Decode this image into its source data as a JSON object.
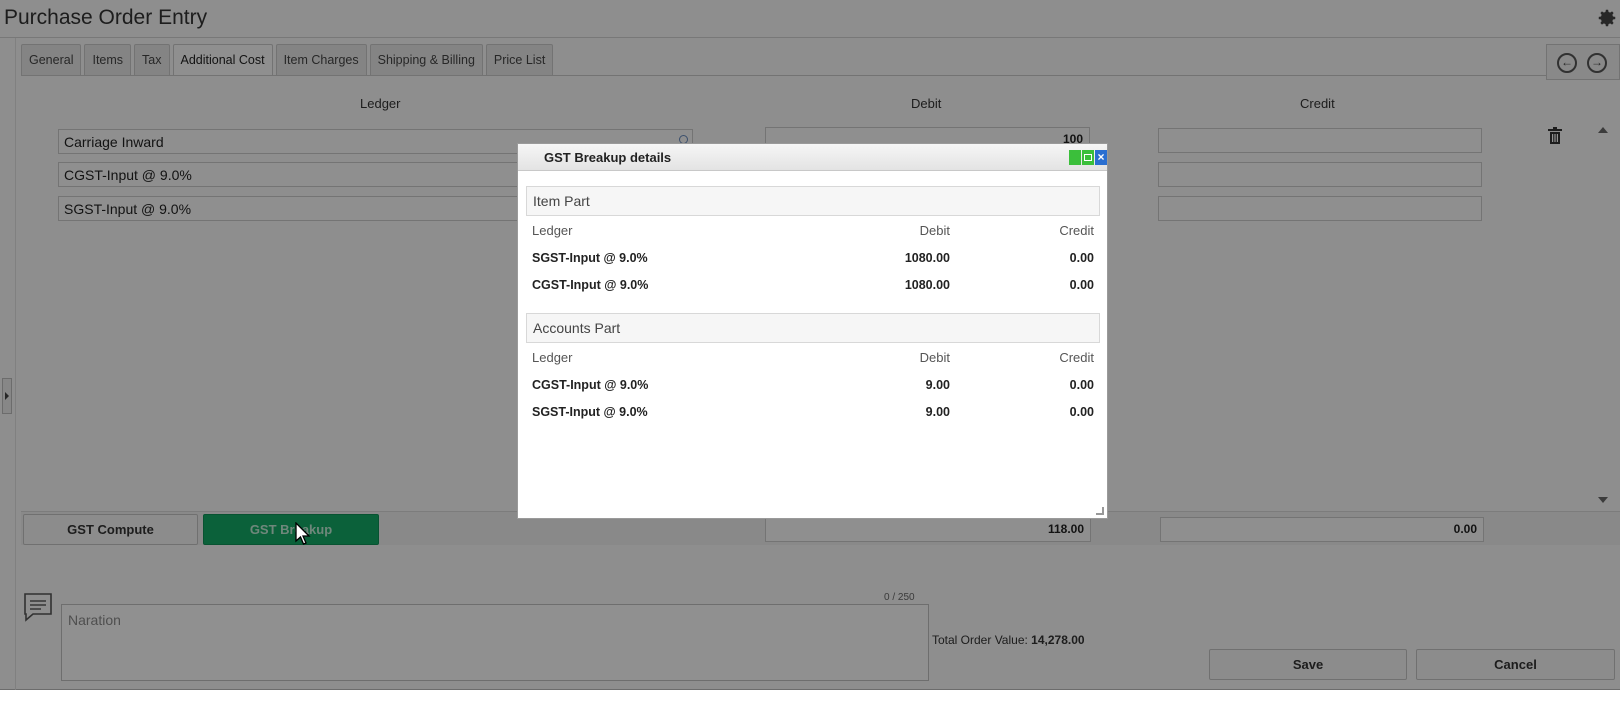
{
  "app": {
    "title": "Purchase Order Entry"
  },
  "tabs": [
    {
      "label": "General"
    },
    {
      "label": "Items"
    },
    {
      "label": "Tax"
    },
    {
      "label": "Additional Cost",
      "active": true
    },
    {
      "label": "Item Charges"
    },
    {
      "label": "Shipping & Billing"
    },
    {
      "label": "Price List"
    }
  ],
  "grid": {
    "headers": {
      "ledger": "Ledger",
      "debit": "Debit",
      "credit": "Credit"
    },
    "rows": [
      {
        "ledger": "Carriage Inward",
        "debit": "100",
        "credit": ""
      },
      {
        "ledger": "CGST-Input @ 9.0%",
        "debit": "",
        "credit": ""
      },
      {
        "ledger": "SGST-Input @ 9.0%",
        "debit": "",
        "credit": ""
      }
    ]
  },
  "buttons": {
    "gst_compute": "GST Compute",
    "gst_breakup": "GST Breakup",
    "save": "Save",
    "cancel": "Cancel"
  },
  "totals": {
    "debit": "118.00",
    "credit": "0.00"
  },
  "narration": {
    "placeholder": "Naration",
    "counter": "0 / 250"
  },
  "order_value": {
    "label": "Total Order Value:",
    "value": "14,278.00"
  },
  "modal": {
    "title": "GST Breakup details",
    "item_part": {
      "title": "Item Part",
      "headers": {
        "ledger": "Ledger",
        "debit": "Debit",
        "credit": "Credit"
      },
      "rows": [
        {
          "ledger": "SGST-Input @ 9.0%",
          "debit": "1080.00",
          "credit": "0.00"
        },
        {
          "ledger": "CGST-Input @ 9.0%",
          "debit": "1080.00",
          "credit": "0.00"
        }
      ]
    },
    "accounts_part": {
      "title": "Accounts Part",
      "headers": {
        "ledger": "Ledger",
        "debit": "Debit",
        "credit": "Credit"
      },
      "rows": [
        {
          "ledger": "CGST-Input @ 9.0%",
          "debit": "9.00",
          "credit": "0.00"
        },
        {
          "ledger": "SGST-Input @ 9.0%",
          "debit": "9.00",
          "credit": "0.00"
        }
      ]
    }
  },
  "colors": {
    "accent_green": "#13a864",
    "close_blue": "#2a6fd1"
  },
  "icons": [
    "gear-icon",
    "arrow-left-icon",
    "arrow-right-icon",
    "search-icon",
    "trash-icon",
    "comment-icon",
    "cursor-icon"
  ]
}
